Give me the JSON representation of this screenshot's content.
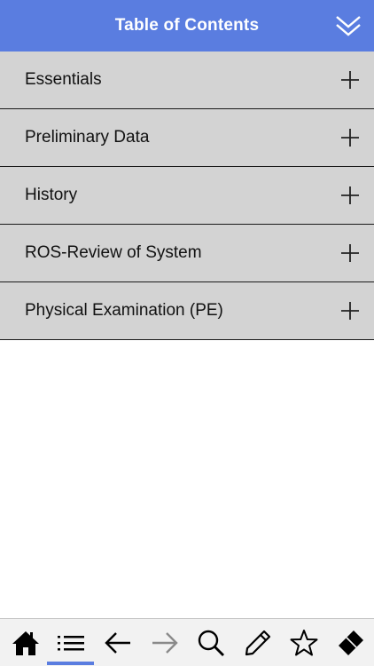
{
  "header": {
    "title": "Table of Contents",
    "collapse_icon": "double-chevron-down-icon"
  },
  "toc": {
    "items": [
      {
        "label": "Essentials",
        "icon": "plus-icon"
      },
      {
        "label": "Preliminary Data",
        "icon": "plus-icon"
      },
      {
        "label": "History",
        "icon": "plus-icon"
      },
      {
        "label": "ROS-Review of System",
        "icon": "plus-icon"
      },
      {
        "label": "Physical Examination (PE)",
        "icon": "plus-icon"
      }
    ]
  },
  "toolbar": {
    "buttons": [
      "home-icon",
      "list-icon",
      "back-arrow-icon",
      "forward-arrow-icon",
      "search-icon",
      "pencil-icon",
      "star-icon",
      "eraser-icon"
    ],
    "active": "list-icon"
  },
  "colors": {
    "accent": "#5a7de0",
    "row_bg": "#d3d3d3",
    "disabled": "#8a8a8a"
  }
}
